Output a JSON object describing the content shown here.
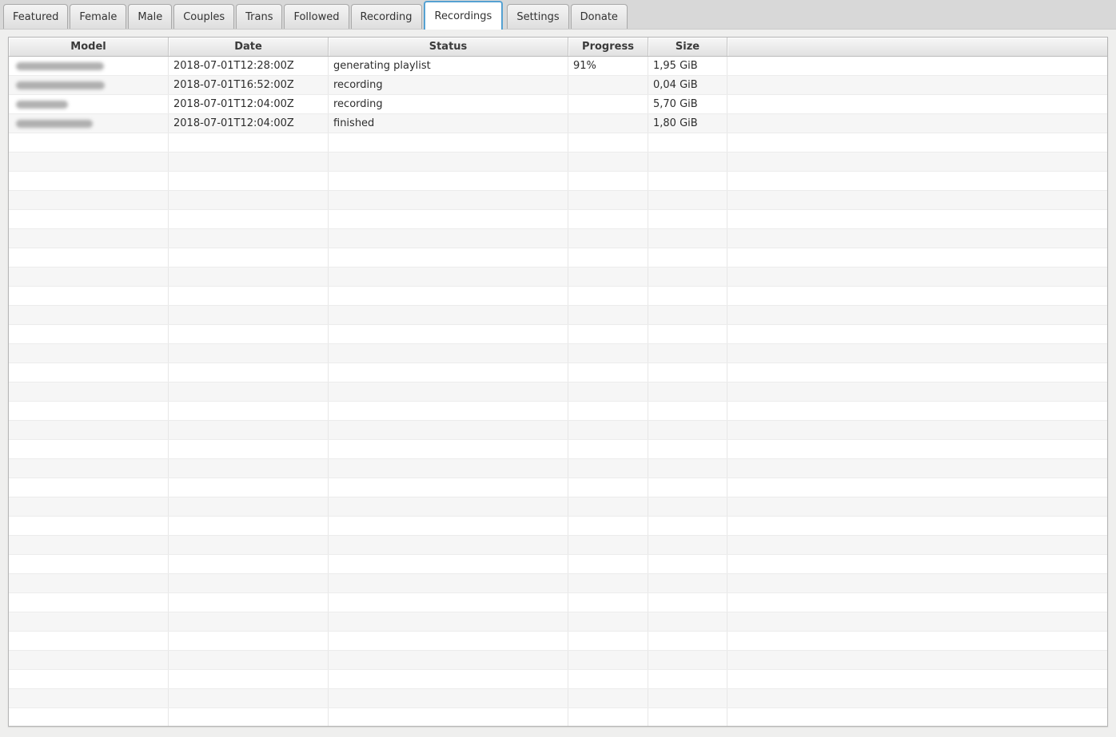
{
  "tabs": [
    {
      "label": "Featured",
      "active": false
    },
    {
      "label": "Female",
      "active": false
    },
    {
      "label": "Male",
      "active": false
    },
    {
      "label": "Couples",
      "active": false
    },
    {
      "label": "Trans",
      "active": false
    },
    {
      "label": "Followed",
      "active": false
    },
    {
      "label": "Recording",
      "active": false
    },
    {
      "label": "Recordings",
      "active": true
    },
    {
      "label": "Settings",
      "active": false
    },
    {
      "label": "Donate",
      "active": false
    }
  ],
  "table": {
    "columns": [
      "Model",
      "Date",
      "Status",
      "Progress",
      "Size",
      ""
    ],
    "rows": [
      {
        "model": "[redacted]",
        "blur_width": 110,
        "date": "2018-07-01T12:28:00Z",
        "status": "generating playlist",
        "progress": "91%",
        "size": "1,95 GiB"
      },
      {
        "model": "[redacted]",
        "blur_width": 111,
        "date": "2018-07-01T16:52:00Z",
        "status": "recording",
        "progress": "",
        "size": "0,04 GiB"
      },
      {
        "model": "[redacted]",
        "blur_width": 65,
        "date": "2018-07-01T12:04:00Z",
        "status": "recording",
        "progress": "",
        "size": "5,70 GiB"
      },
      {
        "model": "[redacted]",
        "blur_width": 96,
        "date": "2018-07-01T12:04:00Z",
        "status": "finished",
        "progress": "",
        "size": "1,80 GiB"
      }
    ],
    "empty_row_count": 31
  },
  "colors": {
    "active_tab_border": "#55a1d2",
    "tabbar_background": "#d8d8d8",
    "row_stripe": "#f6f6f6",
    "header_text": "#3b3b3b"
  }
}
